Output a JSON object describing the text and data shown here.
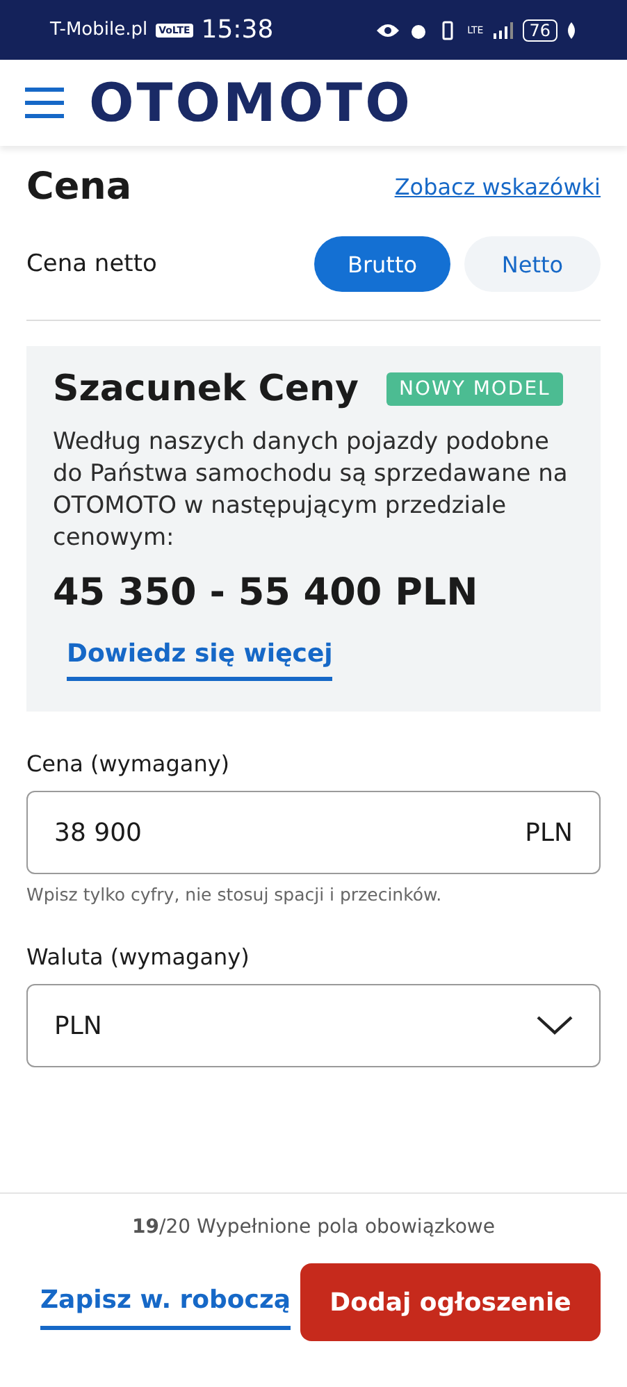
{
  "status_bar": {
    "carrier": "T-Mobile.pl",
    "volte": "VoLTE",
    "time": "15:38",
    "network": "LTE",
    "battery": "76"
  },
  "header": {
    "logo": "OTOMOTO"
  },
  "section": {
    "title": "Cena",
    "link": "Zobacz wskazówki"
  },
  "price_type": {
    "label": "Cena netto",
    "options": [
      {
        "label": "Brutto",
        "selected": true
      },
      {
        "label": "Netto",
        "selected": false
      }
    ]
  },
  "estimate": {
    "title": "Szacunek Ceny",
    "badge": "NOWY MODEL",
    "text": "Według naszych danych pojazdy podobne do Państwa samochodu są sprzedawane na OTOMOTO w następującym przedziale cenowym:",
    "range": "45 350 - 55 400 PLN",
    "link": "Dowiedz się więcej"
  },
  "price_field": {
    "label": "Cena (wymagany)",
    "value": "38 900",
    "unit": "PLN",
    "hint": "Wpisz tylko cyfry, nie stosuj spacji i przecinków."
  },
  "currency_field": {
    "label": "Waluta (wymagany)",
    "value": "PLN"
  },
  "footer": {
    "progress": "**19**/20 Wypełnione pola obowiązkowe",
    "save": "Zapisz w. roboczą",
    "submit": "Dodaj ogłoszenie"
  }
}
